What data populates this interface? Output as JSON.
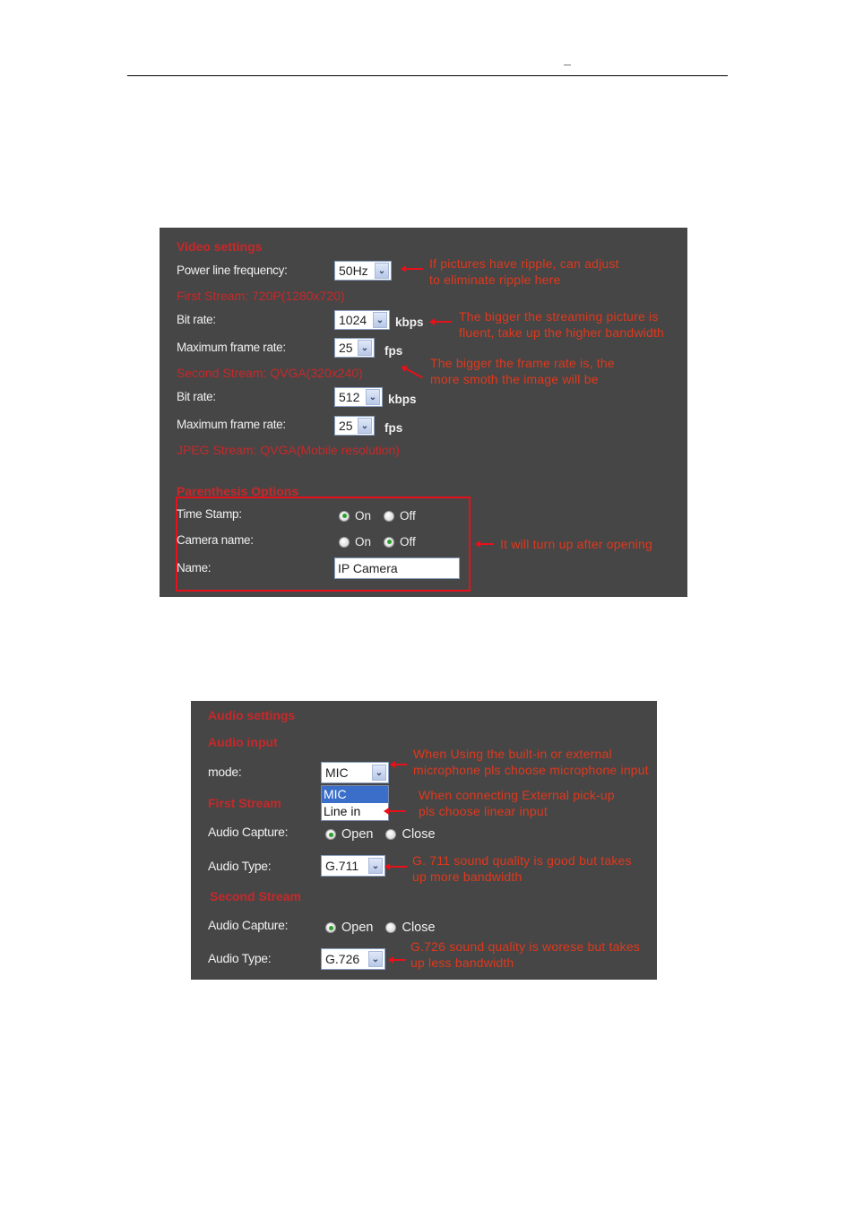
{
  "page_header": {
    "mark": "–"
  },
  "video_settings": {
    "title": "Video settings",
    "power_line": {
      "label": "Power line frequency:",
      "value": "50Hz"
    },
    "first_stream": {
      "title": "First Stream: 720P(1280x720)",
      "bit_rate": {
        "label": "Bit rate:",
        "value": "1024",
        "unit": "kbps"
      },
      "frame_rate": {
        "label": "Maximum frame rate:",
        "value": "25",
        "unit": "fps"
      }
    },
    "second_stream": {
      "title": "Second Stream: QVGA(320x240)",
      "bit_rate": {
        "label": "Bit rate:",
        "value": "512",
        "unit": "kbps"
      },
      "frame_rate": {
        "label": "Maximum frame rate:",
        "value": "25",
        "unit": "fps"
      }
    },
    "jpeg_stream": {
      "title": "JPEG Stream: QVGA(Mobile resolution)"
    },
    "parenthesis_options": {
      "title": "Parenthesis Options",
      "time_stamp": {
        "label": "Time Stamp:",
        "on": "On",
        "off": "Off",
        "selected": "On"
      },
      "camera_name": {
        "label": "Camera name:",
        "on": "On",
        "off": "Off",
        "selected": "Off"
      },
      "name": {
        "label": "Name:",
        "value": "IP Camera"
      }
    },
    "notes": {
      "ripple_1": "If pictures have ripple, can adjust",
      "ripple_2": "to eliminate ripple here",
      "bitrate_1": "The bigger the streaming picture is",
      "bitrate_2": "fluent, take up the higher bandwidth",
      "framerate_1": "The bigger the frame rate is, the",
      "framerate_2": "more smoth the image will be",
      "osd": "It will turn up after opening"
    }
  },
  "audio_settings": {
    "title": "Audio settings",
    "audio_input": {
      "title": "Audio input",
      "mode": {
        "label": "mode:",
        "value": "MIC",
        "options": [
          "MIC",
          "Line in"
        ]
      }
    },
    "first_stream": {
      "title": "First Stream",
      "capture": {
        "label": "Audio Capture:",
        "open": "Open",
        "close": "Close",
        "selected": "Open"
      },
      "type": {
        "label": "Audio Type:",
        "value": "G.711"
      }
    },
    "second_stream": {
      "title": "Second Stream",
      "capture": {
        "label": "Audio Capture:",
        "open": "Open",
        "close": "Close",
        "selected": "Open"
      },
      "type": {
        "label": "Audio Type:",
        "value": "G.726"
      }
    },
    "notes": {
      "mic_1": "When Using the built-in or external",
      "mic_2": "microphone pls choose microphone input",
      "linein_1": "When connecting External pick-up",
      "linein_2": "pls choose linear input",
      "g711_1": "G. 711 sound quality is good but takes",
      "g711_2": "up more bandwidth",
      "g726_1": "G.726 sound quality is worese but takes",
      "g726_2": "up less bandwidth"
    }
  },
  "colors": {
    "panel_bg": "#464646",
    "section_title": "#c8282a",
    "annotation": "#e0381c",
    "highlight": "#e8101a"
  }
}
